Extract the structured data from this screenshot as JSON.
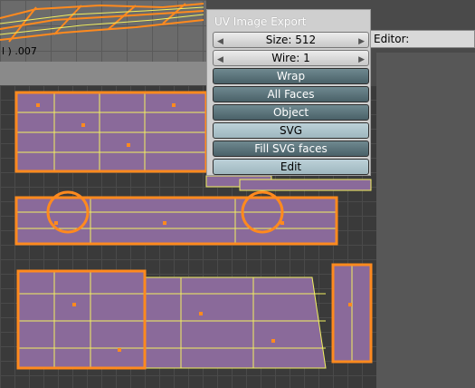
{
  "viewport": {
    "object_label": "l ) .007"
  },
  "export_panel": {
    "title": "UV Image Export",
    "size_label": "Size: 512",
    "wire_label": "Wire: 1",
    "wrap_label": "Wrap",
    "all_faces_label": "All Faces",
    "object_label": "Object",
    "svg_label": "SVG",
    "fill_svg_label": "Fill SVG faces",
    "edit_label": "Edit"
  },
  "editor_field": {
    "label": "Editor:"
  },
  "colors": {
    "wire_orange": "#ff8a1e",
    "wire_yellow": "#f2f060",
    "face_purple": "#8a6a9a",
    "toggle_off": "#4a6168",
    "toggle_on": "#9fb7bf"
  },
  "icons": {
    "left_arrow": "◀",
    "right_arrow": "▶"
  }
}
